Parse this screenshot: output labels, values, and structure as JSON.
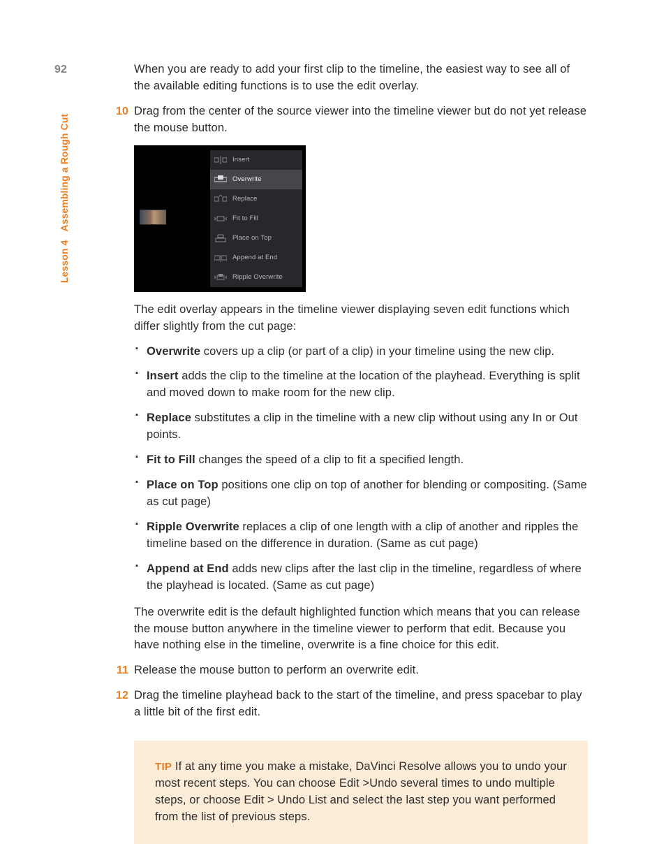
{
  "page_number": "92",
  "side_label_lesson": "Lesson 4",
  "side_label_title": "Assembling a Rough Cut",
  "intro_para": "When you are ready to add your first clip to the timeline, the easiest way to see all of the available editing functions is to use the edit overlay.",
  "step10_num": "10",
  "step10_text": "Drag from the center of the source viewer into the timeline viewer but do not yet release the mouse button.",
  "overlay_items": [
    {
      "label": "Insert"
    },
    {
      "label": "Overwrite"
    },
    {
      "label": "Replace"
    },
    {
      "label": "Fit to Fill"
    },
    {
      "label": "Place on Top"
    },
    {
      "label": "Append at End"
    },
    {
      "label": "Ripple Overwrite"
    }
  ],
  "after_overlay_para": "The edit overlay appears in the timeline viewer displaying seven edit functions which differ slightly from the cut page:",
  "bullets": [
    {
      "term": "Overwrite",
      "desc": " covers up a clip (or part of a clip) in your timeline using the new clip."
    },
    {
      "term": "Insert",
      "desc": " adds the clip to the timeline at the location of the playhead. Everything is split and moved down to make room for the new clip."
    },
    {
      "term": "Replace",
      "desc": " substitutes a clip in the timeline with a new clip without using any In or Out points."
    },
    {
      "term": "Fit to Fill",
      "desc": " changes the speed of a clip to fit a specified length."
    },
    {
      "term": "Place on Top",
      "desc": " positions one clip on top of another for blending or compositing. (Same as cut page)"
    },
    {
      "term": "Ripple Overwrite",
      "desc": " replaces a clip of one length with a clip of another and ripples the timeline based on the difference in duration. (Same as cut page)"
    },
    {
      "term": "Append at End",
      "desc": " adds new clips after the last clip in the timeline, regardless of where the playhead is located. (Same as cut page)"
    }
  ],
  "after_bullets_para": "The overwrite edit is the default highlighted function which means that you can release the mouse button anywhere in the timeline viewer to perform that edit. Because you have nothing else in the timeline, overwrite is a fine choice for this edit.",
  "step11_num": "11",
  "step11_text": "Release the mouse button to perform an overwrite edit.",
  "step12_num": "12",
  "step12_text": "Drag the timeline playhead back to the start of the timeline, and press spacebar to play a little bit of the first edit.",
  "tip_label": "TIP",
  "tip_text": "  If at any time you make a mistake, DaVinci Resolve allows you to undo your most recent steps. You can choose Edit >Undo several times to undo multiple steps, or choose Edit > Undo List and select the last step you want performed from the list of previous steps."
}
